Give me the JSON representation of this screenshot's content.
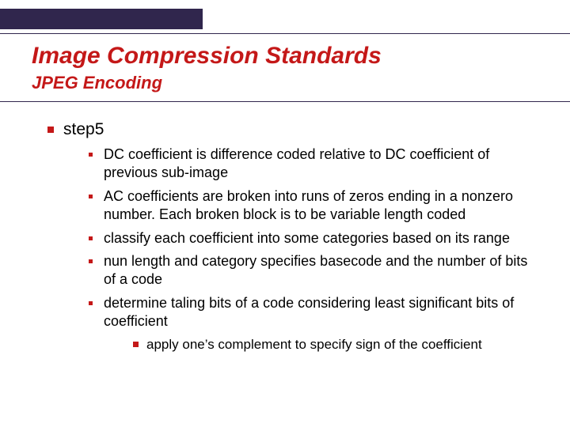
{
  "title": "Image Compression Standards",
  "subtitle": "JPEG Encoding",
  "step_label": "step5",
  "bullets": {
    "b0": "DC coefficient is difference coded relative to DC coefficient of previous sub-image",
    "b1": "AC coefficients are broken into runs of zeros ending in a nonzero number. Each broken block is to be variable length coded",
    "b2": "classify each coefficient into some categories based on its range",
    "b3": "nun length and category specifies basecode and the number of bits of a code",
    "b4": "determine taling bits of a code considering least significant bits of coefficient"
  },
  "sub_bullet": "apply one’s complement to specify sign of the coefficient"
}
